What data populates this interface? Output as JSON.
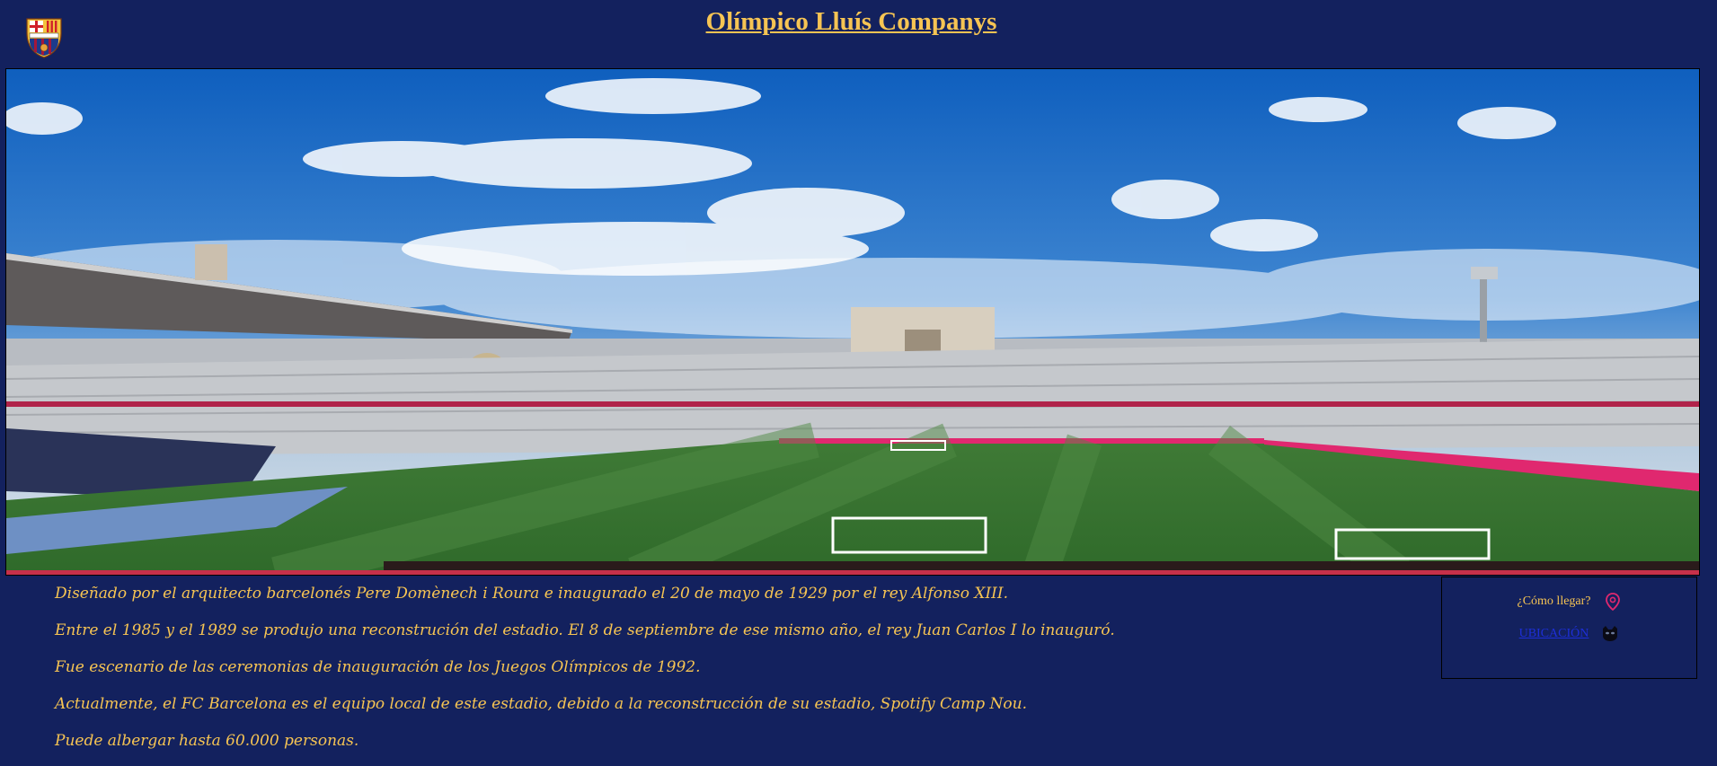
{
  "header": {
    "title": "Olímpico Lluís Companys",
    "logo_icon": "fc-barcelona-crest-icon"
  },
  "banner": {
    "image": "stadium-panorama"
  },
  "facts": [
    "Diseñado por el arquitecto barcelonés Pere Domènech i Roura e inaugurado el 20 de mayo de 1929 por el rey Alfonso XIII.",
    "Entre el 1985 y el 1989 se produjo una reconstrución del estadio. El 8 de septiembre de ese mismo año, el rey Juan Carlos I lo inauguró.",
    "Fue escenario de las ceremonias de inauguración de los Juegos Olímpicos de 1992.",
    "Actualmente, el FC Barcelona es el equipo local de este estadio, debido a la reconstrucción de su estadio, Spotify Camp Nou.",
    "Puede albergar hasta 60.000 personas."
  ],
  "panel": {
    "how_to_get": "¿Cómo llegar?",
    "location_link": "UBICACIÓN",
    "pin_icon": "map-pin-icon",
    "mask_icon": "mask-icon"
  },
  "colors": {
    "background": "#13215e",
    "accent": "#f6c453",
    "link": "#1d2fd9",
    "pin": "#e0286f"
  }
}
